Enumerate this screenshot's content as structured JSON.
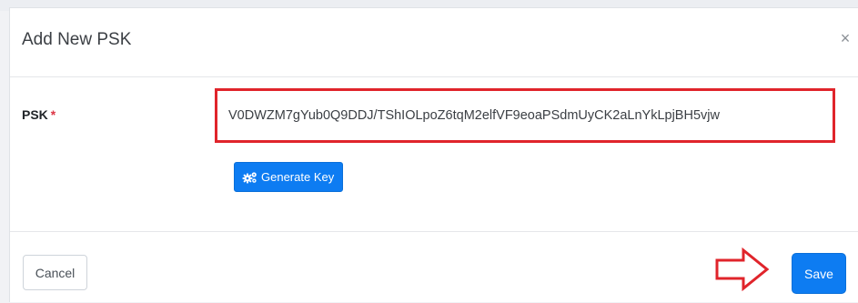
{
  "modal": {
    "title": "Add New PSK",
    "close_symbol": "×",
    "close_icon": "close-icon"
  },
  "form": {
    "psk_label": "PSK",
    "required_mark": "*",
    "psk_value": "V0DWZM7gYub0Q9DDJ/TShIOLpoZ6tqM2elfVF9eoaPSdmUyCK2aLnYkLpjBH5vjw",
    "generate_label": "Generate Key",
    "generate_icon": "cogs-icon"
  },
  "footer": {
    "cancel_label": "Cancel",
    "save_label": "Save"
  },
  "annotations": {
    "highlight_color": "#e0242b",
    "arrow_icon": "right-arrow-outline-icon"
  },
  "colors": {
    "primary": "#0d7cf2",
    "required": "#dc3545"
  }
}
